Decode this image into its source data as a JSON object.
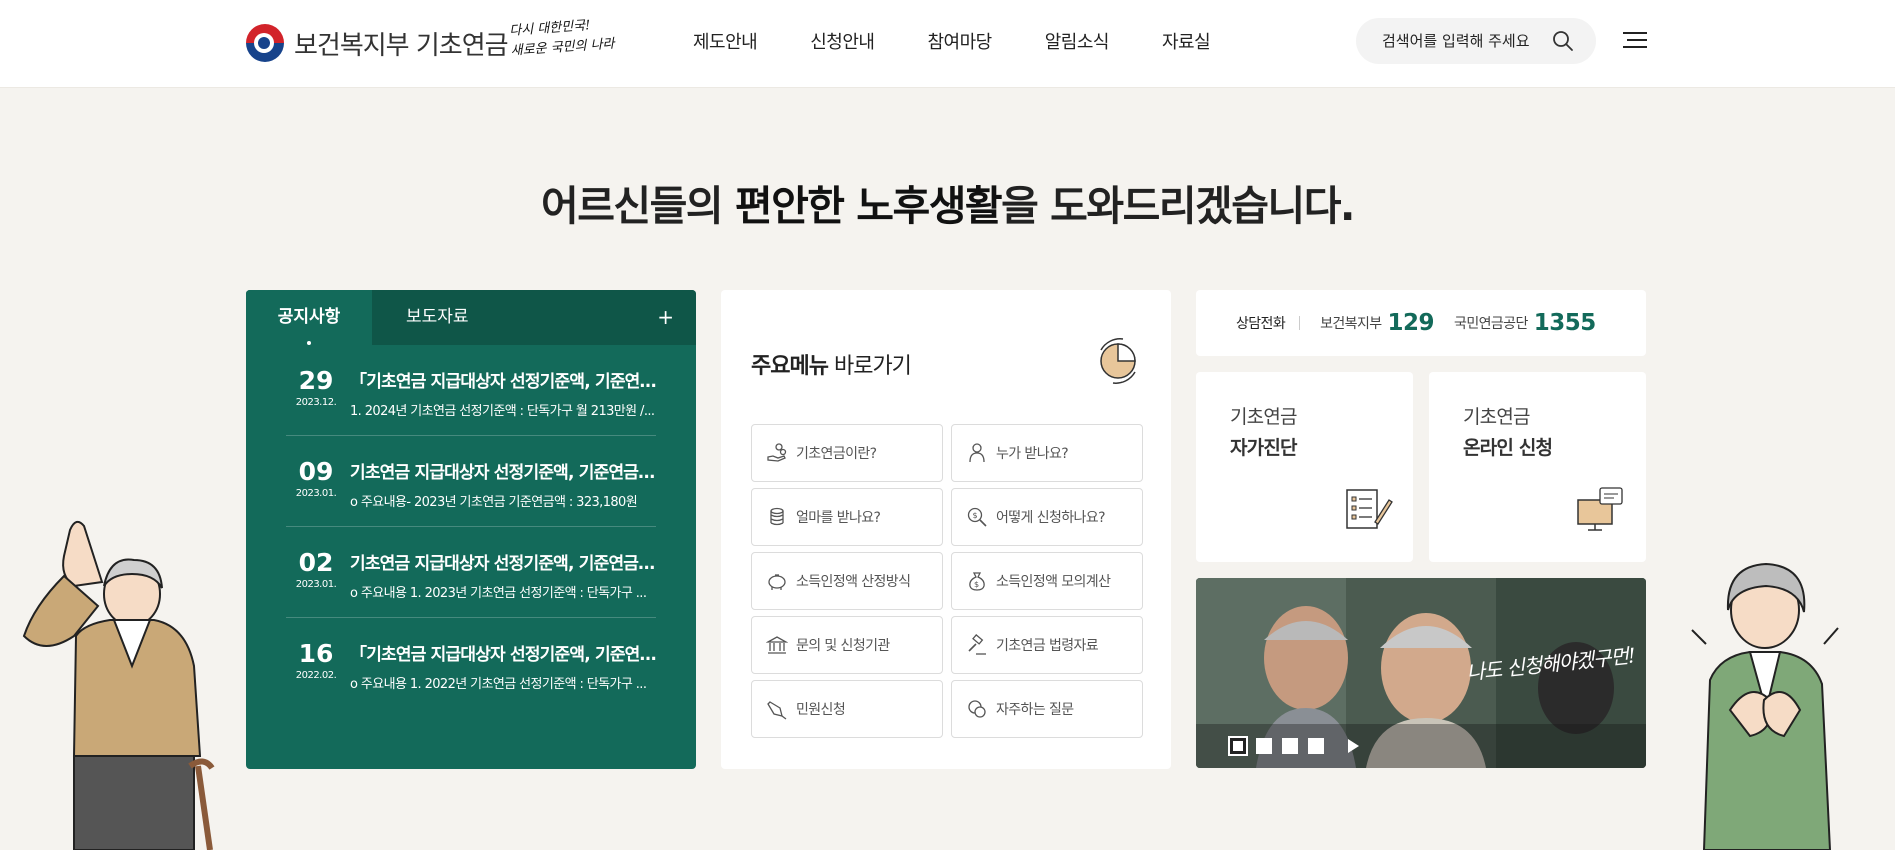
{
  "header": {
    "logo_text": "보건복지부 기초연금",
    "slogan_line1": "다시 대한민국!",
    "slogan_line2": "새로운 국민의 나라",
    "nav": [
      "제도안내",
      "신청안내",
      "참여마당",
      "알림소식",
      "자료실"
    ],
    "search_placeholder": "검색어를 입력해 주세요"
  },
  "hero": {
    "prefix": "어르신들의 ",
    "bold": "편안한 노후생활",
    "suffix": "을 도와드리겠습니다."
  },
  "notice": {
    "tabs": [
      "공지사항",
      "보도자료"
    ],
    "plus": "+",
    "items": [
      {
        "day": "29",
        "ym": "2023.12.",
        "title": "「기초연금 지급대상자 선정기준액, 기준연금액...",
        "desc": "1. 2024년 기초연금 선정기준액 : 단독가구 월 213만원 /..."
      },
      {
        "day": "09",
        "ym": "2023.01.",
        "title": "기초연금 지급대상자 선정기준액, 기준연금액...",
        "desc": "o 주요내용- 2023년 기초연금 기준연금액 : 323,180원"
      },
      {
        "day": "02",
        "ym": "2023.01.",
        "title": "기초연금 지급대상자 선정기준액, 기준연금액...",
        "desc": "o 주요내용 1. 2023년 기초연금 선정기준액 : 단독가구 ..."
      },
      {
        "day": "16",
        "ym": "2022.02.",
        "title": "「기초연금 지급대상자 선정기준액, 기준연금...",
        "desc": "o 주요내용 1. 2022년 기초연금 선정기준액 : 단독가구 ..."
      }
    ]
  },
  "quick": {
    "title_bold": "주요메뉴",
    "title_rest": " 바로가기",
    "items": [
      {
        "label": "기초연금이란?",
        "icon": "coins-hand-icon"
      },
      {
        "label": "누가 받나요?",
        "icon": "person-icon"
      },
      {
        "label": "얼마를 받나요?",
        "icon": "coin-stack-icon"
      },
      {
        "label": "어떻게 신청하나요?",
        "icon": "magnifier-money-icon"
      },
      {
        "label": "소득인정액 산정방식",
        "icon": "piggy-bank-icon"
      },
      {
        "label": "소득인정액 모의계산",
        "icon": "money-bag-icon"
      },
      {
        "label": "문의 및 신청기관",
        "icon": "bank-building-icon"
      },
      {
        "label": "기초연금 법령자료",
        "icon": "gavel-icon"
      },
      {
        "label": "민원신청",
        "icon": "pen-icon"
      },
      {
        "label": "자주하는 질문",
        "icon": "chat-bubbles-icon"
      }
    ]
  },
  "contact": {
    "label": "상담전화",
    "org1": "보건복지부",
    "num1": "129",
    "org2": "국민연금공단",
    "num2": "1355"
  },
  "cards": [
    {
      "line1": "기초연금",
      "line2": "자가진단",
      "icon": "checklist-icon"
    },
    {
      "line1": "기초연금",
      "line2": "온라인 신청",
      "icon": "computer-chat-icon"
    }
  ],
  "banner": {
    "text": "나도 신청해야겠구먼!",
    "slides": 4
  },
  "colors": {
    "primary_green": "#136a5a",
    "background": "#f5f3ef"
  }
}
